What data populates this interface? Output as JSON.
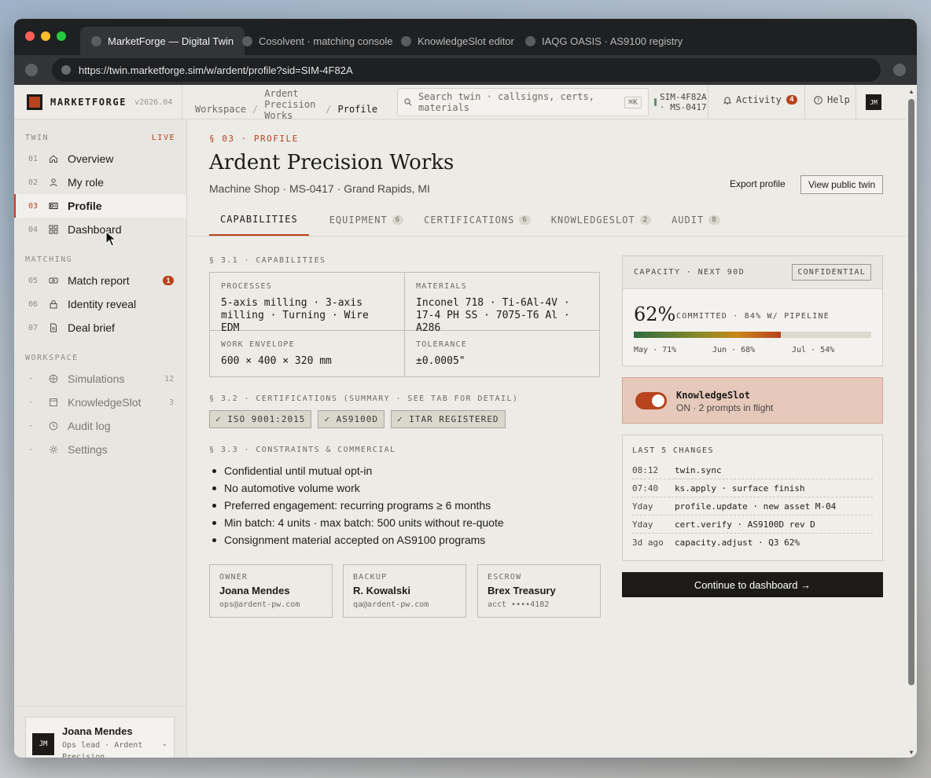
{
  "browser": {
    "tabs": [
      {
        "label": "MarketForge — Digital Twin",
        "active": true
      },
      {
        "label": "Cosolvent · matching console",
        "active": false
      },
      {
        "label": "KnowledgeSlot editor",
        "active": false
      },
      {
        "label": "IAQG OASIS · AS9100 registry",
        "active": false
      }
    ],
    "url": "https://twin.marketforge.sim/w/ardent/profile?sid=SIM-4F82A"
  },
  "topbar": {
    "brand": "MARKETFORGE",
    "version": "v2026.04",
    "breadcrumb": [
      "Workspace",
      "Ardent Precision Works",
      "Profile"
    ],
    "search_placeholder": "Search twin · callsigns, certs, materials",
    "search_shortcut": "⌘K",
    "sim_chip": "SIM-4F82A · MS-0417",
    "activity_label": "Activity",
    "activity_count": "4",
    "help_label": "Help",
    "avatar_initials": "JM"
  },
  "sidebar": {
    "twin_label": "TWIN",
    "live_label": "LIVE",
    "twin_items": [
      {
        "num": "01",
        "label": "Overview",
        "icon": "home-icon"
      },
      {
        "num": "02",
        "label": "My role",
        "icon": "user-icon"
      },
      {
        "num": "03",
        "label": "Profile",
        "icon": "id-card-icon",
        "active": true
      },
      {
        "num": "04",
        "label": "Dashboard",
        "icon": "grid-icon"
      }
    ],
    "matching_label": "MATCHING",
    "matching_items": [
      {
        "num": "05",
        "label": "Match report",
        "icon": "ticket-icon",
        "badge": "1"
      },
      {
        "num": "06",
        "label": "Identity reveal",
        "icon": "lock-icon"
      },
      {
        "num": "07",
        "label": "Deal brief",
        "icon": "document-icon"
      }
    ],
    "workspace_label": "WORKSPACE",
    "workspace_items": [
      {
        "num": "·",
        "label": "Simulations",
        "icon": "globe-icon",
        "count": "12"
      },
      {
        "num": "·",
        "label": "KnowledgeSlot",
        "icon": "square-icon",
        "count": "3"
      },
      {
        "num": "·",
        "label": "Audit log",
        "icon": "clock-icon"
      },
      {
        "num": "·",
        "label": "Settings",
        "icon": "gear-icon"
      }
    ],
    "user": {
      "name": "Joana Mendes",
      "role": "Ops lead · Ardent Precision",
      "initials": "JM"
    }
  },
  "main": {
    "eyebrow": "§ 03 · PROFILE",
    "title": "Ardent Precision Works",
    "subtitle": "Machine Shop · MS-0417 · Grand Rapids, MI",
    "export_label": "Export profile",
    "public_label": "View public twin",
    "tabs": [
      {
        "label": "CAPABILITIES",
        "active": true
      },
      {
        "label": "EQUIPMENT",
        "count": "6"
      },
      {
        "label": "CERTIFICATIONS",
        "count": "6"
      },
      {
        "label": "KNOWLEDGESLOT",
        "count": "2"
      },
      {
        "label": "AUDIT",
        "count": "8"
      }
    ],
    "capabilities": {
      "heading": "§ 3.1 · CAPABILITIES",
      "processes_label": "PROCESSES",
      "processes": "5-axis milling · 3-axis milling · Turning · Wire EDM",
      "materials_label": "MATERIALS",
      "materials": "Inconel 718 · Ti-6Al-4V · 17-4 PH SS · 7075-T6 Al · A286",
      "envelope_label": "WORK ENVELOPE",
      "envelope": "600 × 400 × 320 mm",
      "tolerance_label": "TOLERANCE",
      "tolerance": "±0.0005\""
    },
    "certs": {
      "heading": "§ 3.2 · CERTIFICATIONS (SUMMARY · SEE TAB FOR DETAIL)",
      "pills": [
        "✓ ISO 9001:2015",
        "✓ AS9100D",
        "✓ ITAR REGISTERED"
      ]
    },
    "constraints": {
      "heading": "§ 3.3 · CONSTRAINTS & COMMERCIAL",
      "items": [
        "Confidential until mutual opt-in",
        "No automotive volume work",
        "Preferred engagement: recurring programs ≥ 6 months",
        "Min batch: 4 units · max batch: 500 units without re-quote",
        "Consignment material accepted on AS9100 programs"
      ]
    },
    "contacts": [
      {
        "label": "OWNER",
        "name": "Joana Mendes",
        "sub": "ops@ardent-pw.com"
      },
      {
        "label": "BACKUP",
        "name": "R. Kowalski",
        "sub": "qa@ardent-pw.com"
      },
      {
        "label": "ESCROW",
        "name": "Brex Treasury",
        "sub": "acct ••••4182"
      }
    ]
  },
  "capacity": {
    "heading": "CAPACITY · NEXT 90D",
    "badge": "CONFIDENTIAL",
    "value": "62%",
    "fill_fraction": 0.62,
    "note": "COMMITTED · 84% W/ PIPELINE",
    "months": [
      "May · 71%",
      "Jun · 68%",
      "Jul · 54%"
    ]
  },
  "knowledgeslot": {
    "title": "KnowledgeSlot",
    "status": "ON · 2 prompts in flight",
    "enabled": true
  },
  "changes": {
    "heading": "LAST 5 CHANGES",
    "rows": [
      {
        "time": "08:12",
        "text": "twin.sync"
      },
      {
        "time": "07:40",
        "text": "ks.apply · surface finish"
      },
      {
        "time": "Yday",
        "text": "profile.update · new asset M-04"
      },
      {
        "time": "Yday",
        "text": "cert.verify · AS9100D rev D"
      },
      {
        "time": "3d ago",
        "text": "capacity.adjust · Q3 62%"
      }
    ]
  },
  "cta_label": "Continue to dashboard →"
}
